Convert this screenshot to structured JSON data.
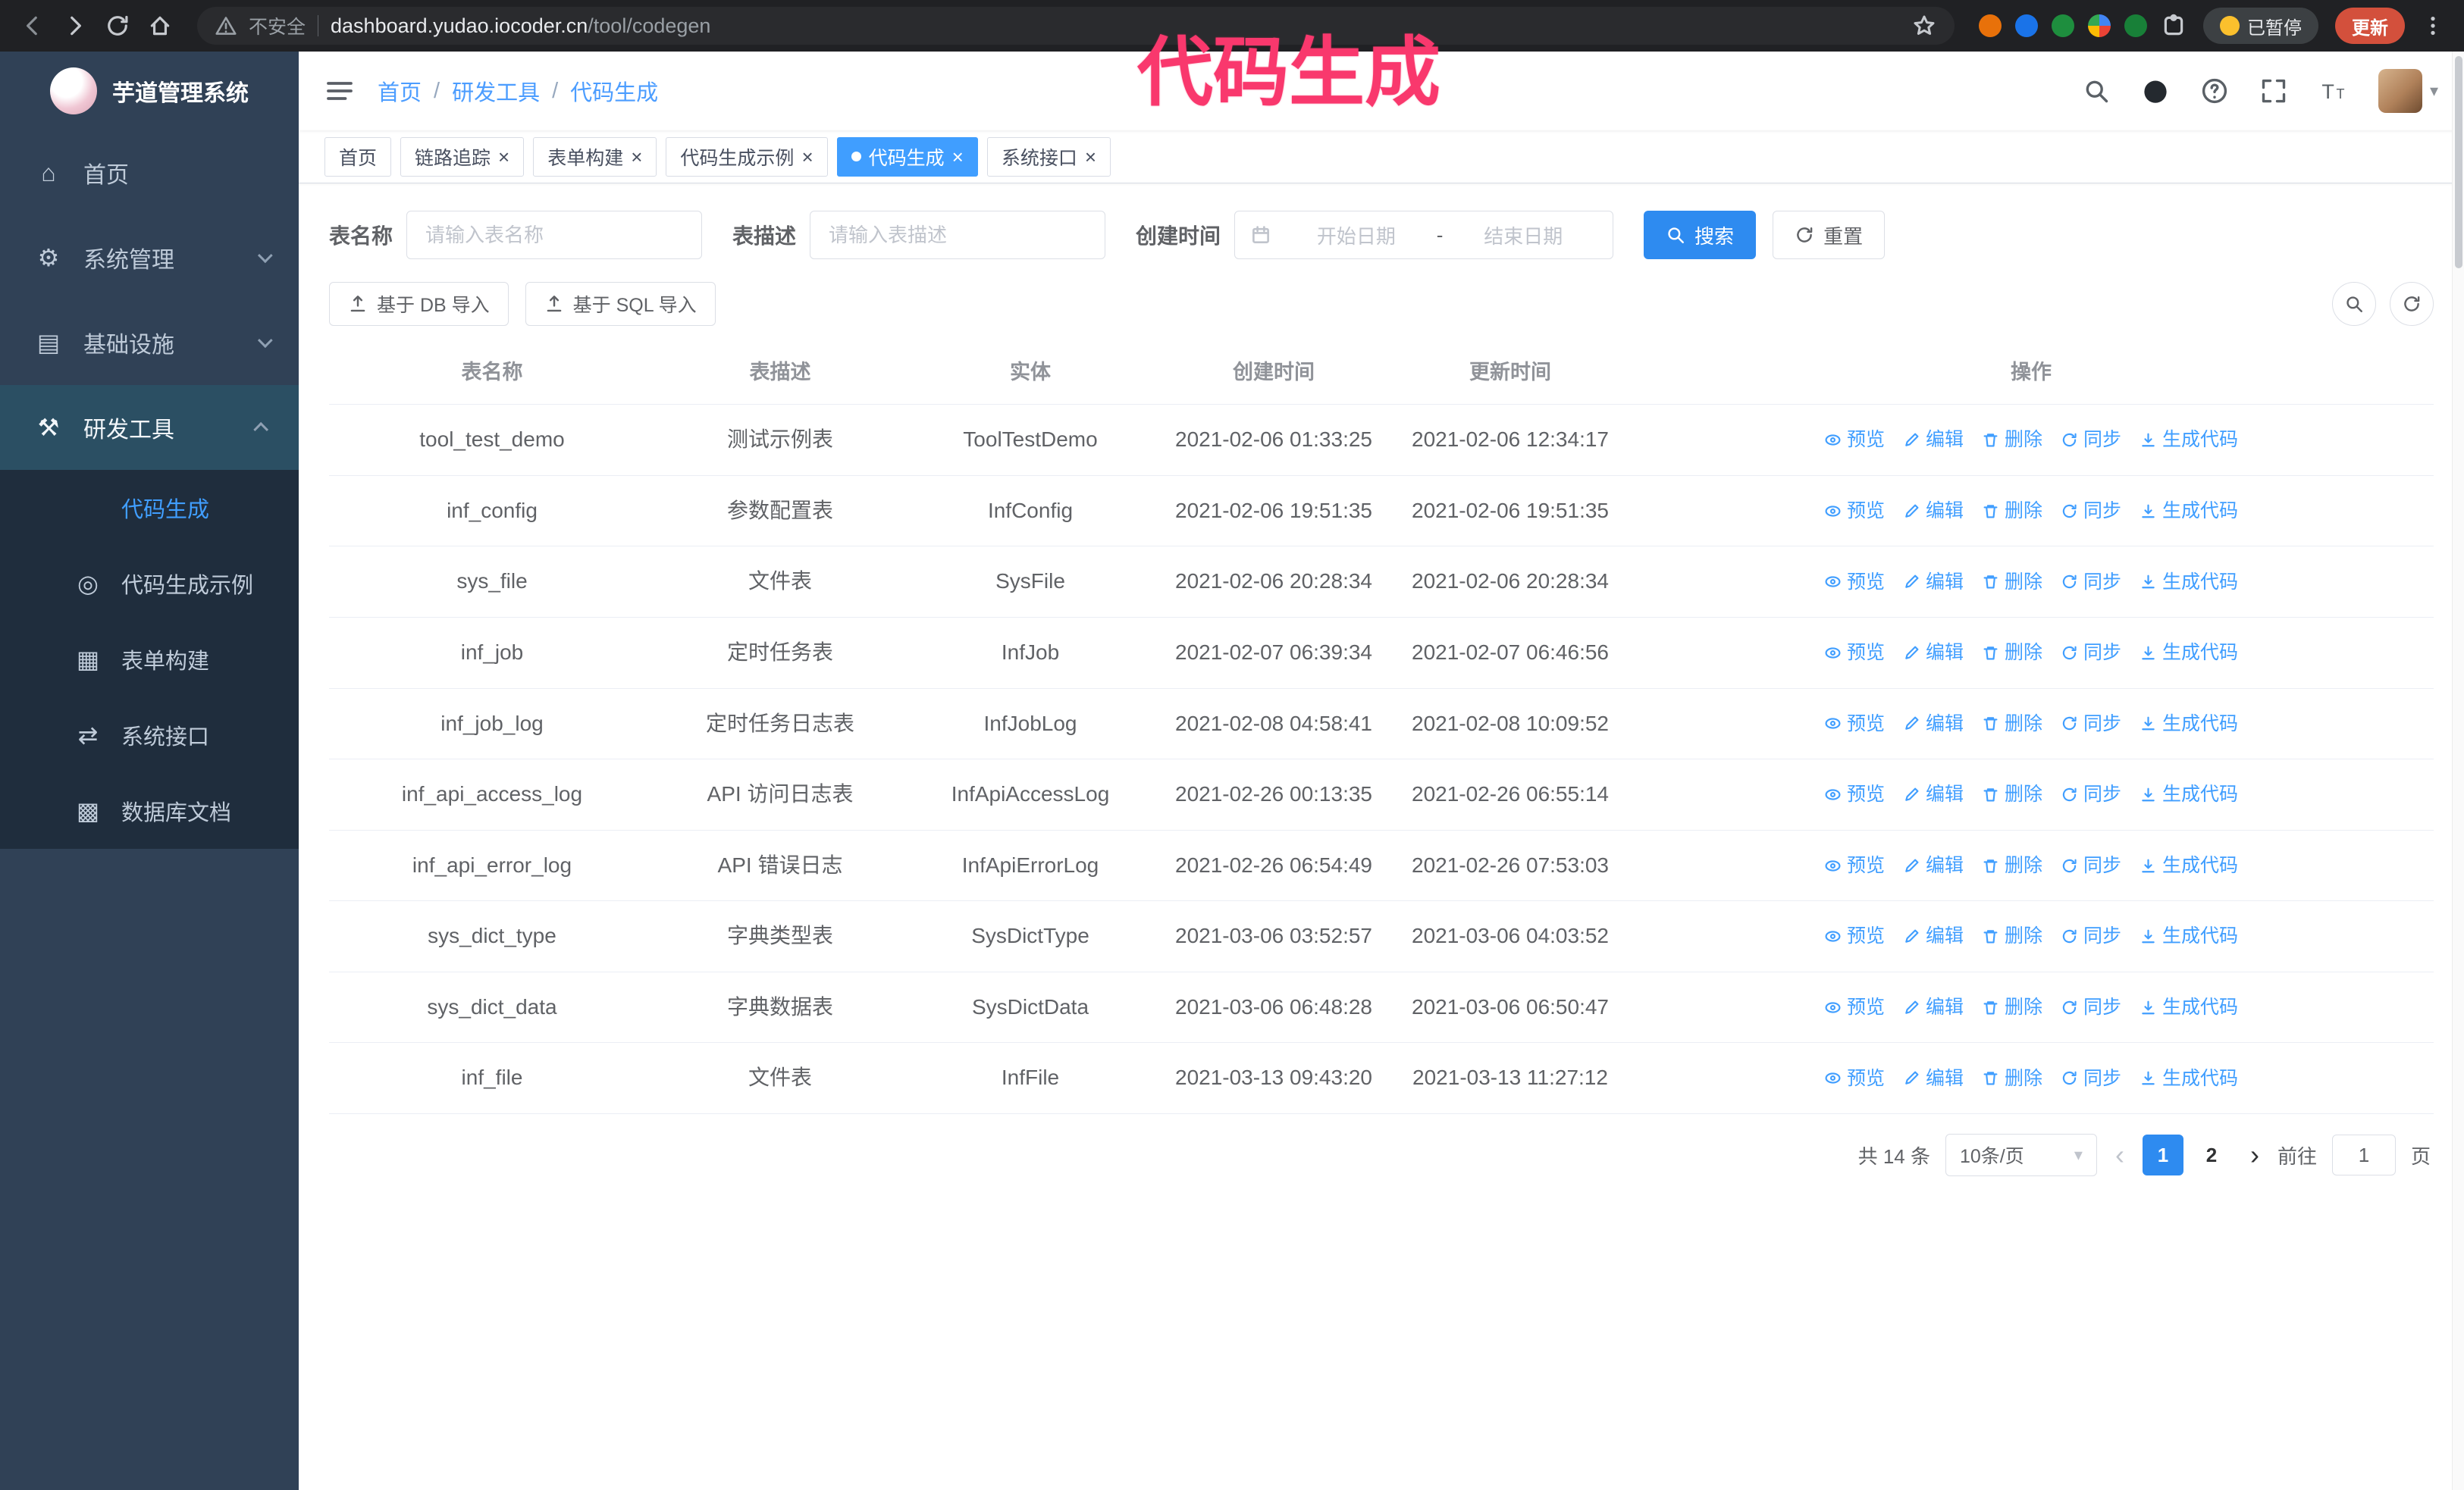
{
  "annotation": "代码生成",
  "browser": {
    "security_label": "不安全",
    "url_host": "dashboard.yudao.iocoder.cn",
    "url_path": "/tool/codegen",
    "paused_badge": "已暂停",
    "update_button": "更新"
  },
  "sidebar": {
    "logo_title": "芋道管理系统",
    "items": [
      {
        "label": "首页",
        "icon": "home"
      },
      {
        "label": "系统管理",
        "icon": "gear",
        "expandable": true
      },
      {
        "label": "基础设施",
        "icon": "infra",
        "expandable": true
      },
      {
        "label": "研发工具",
        "icon": "tools",
        "expandable": true,
        "expanded": true,
        "children": [
          {
            "label": "代码生成",
            "icon": "code",
            "active": true
          },
          {
            "label": "代码生成示例",
            "icon": "example"
          },
          {
            "label": "表单构建",
            "icon": "form"
          },
          {
            "label": "系统接口",
            "icon": "api"
          },
          {
            "label": "数据库文档",
            "icon": "db"
          }
        ]
      }
    ]
  },
  "header": {
    "breadcrumb": [
      "首页",
      "研发工具",
      "代码生成"
    ]
  },
  "tabs": [
    {
      "label": "首页",
      "closable": false
    },
    {
      "label": "链路追踪",
      "closable": true
    },
    {
      "label": "表单构建",
      "closable": true
    },
    {
      "label": "代码生成示例",
      "closable": true
    },
    {
      "label": "代码生成",
      "closable": true,
      "active": true
    },
    {
      "label": "系统接口",
      "closable": true
    }
  ],
  "filters": {
    "table_name_label": "表名称",
    "table_name_placeholder": "请输入表名称",
    "table_desc_label": "表描述",
    "table_desc_placeholder": "请输入表描述",
    "create_time_label": "创建时间",
    "date_start_placeholder": "开始日期",
    "date_separator": "-",
    "date_end_placeholder": "结束日期",
    "search_button": "搜索",
    "reset_button": "重置"
  },
  "toolbar": {
    "import_db": "基于 DB 导入",
    "import_sql": "基于 SQL 导入"
  },
  "table": {
    "columns": [
      "表名称",
      "表描述",
      "实体",
      "创建时间",
      "更新时间",
      "操作"
    ],
    "actions": [
      {
        "label": "预览",
        "icon": "eye"
      },
      {
        "label": "编辑",
        "icon": "edit"
      },
      {
        "label": "删除",
        "icon": "trash"
      },
      {
        "label": "同步",
        "icon": "sync"
      },
      {
        "label": "生成代码",
        "icon": "download"
      }
    ],
    "rows": [
      {
        "name": "tool_test_demo",
        "desc": "测试示例表",
        "entity": "ToolTestDemo",
        "created": "2021-02-06 01:33:25",
        "updated": "2021-02-06 12:34:17"
      },
      {
        "name": "inf_config",
        "desc": "参数配置表",
        "entity": "InfConfig",
        "created": "2021-02-06 19:51:35",
        "updated": "2021-02-06 19:51:35"
      },
      {
        "name": "sys_file",
        "desc": "文件表",
        "entity": "SysFile",
        "created": "2021-02-06 20:28:34",
        "updated": "2021-02-06 20:28:34"
      },
      {
        "name": "inf_job",
        "desc": "定时任务表",
        "entity": "InfJob",
        "created": "2021-02-07 06:39:34",
        "updated": "2021-02-07 06:46:56"
      },
      {
        "name": "inf_job_log",
        "desc": "定时任务日志表",
        "entity": "InfJobLog",
        "created": "2021-02-08 04:58:41",
        "updated": "2021-02-08 10:09:52"
      },
      {
        "name": "inf_api_access_log",
        "desc": "API 访问日志表",
        "entity": "InfApiAccessLog",
        "created": "2021-02-26 00:13:35",
        "updated": "2021-02-26 06:55:14"
      },
      {
        "name": "inf_api_error_log",
        "desc": "API 错误日志",
        "entity": "InfApiErrorLog",
        "created": "2021-02-26 06:54:49",
        "updated": "2021-02-26 07:53:03"
      },
      {
        "name": "sys_dict_type",
        "desc": "字典类型表",
        "entity": "SysDictType",
        "created": "2021-03-06 03:52:57",
        "updated": "2021-03-06 04:03:52"
      },
      {
        "name": "sys_dict_data",
        "desc": "字典数据表",
        "entity": "SysDictData",
        "created": "2021-03-06 06:48:28",
        "updated": "2021-03-06 06:50:47"
      },
      {
        "name": "inf_file",
        "desc": "文件表",
        "entity": "InfFile",
        "created": "2021-03-13 09:43:20",
        "updated": "2021-03-13 11:27:12"
      }
    ]
  },
  "pagination": {
    "total": "共 14 条",
    "page_size": "10条/页",
    "pages": [
      {
        "label": "1",
        "active": true
      },
      {
        "label": "2",
        "active": false
      }
    ],
    "goto_label": "前往",
    "goto_value": "1",
    "goto_suffix": "页"
  }
}
